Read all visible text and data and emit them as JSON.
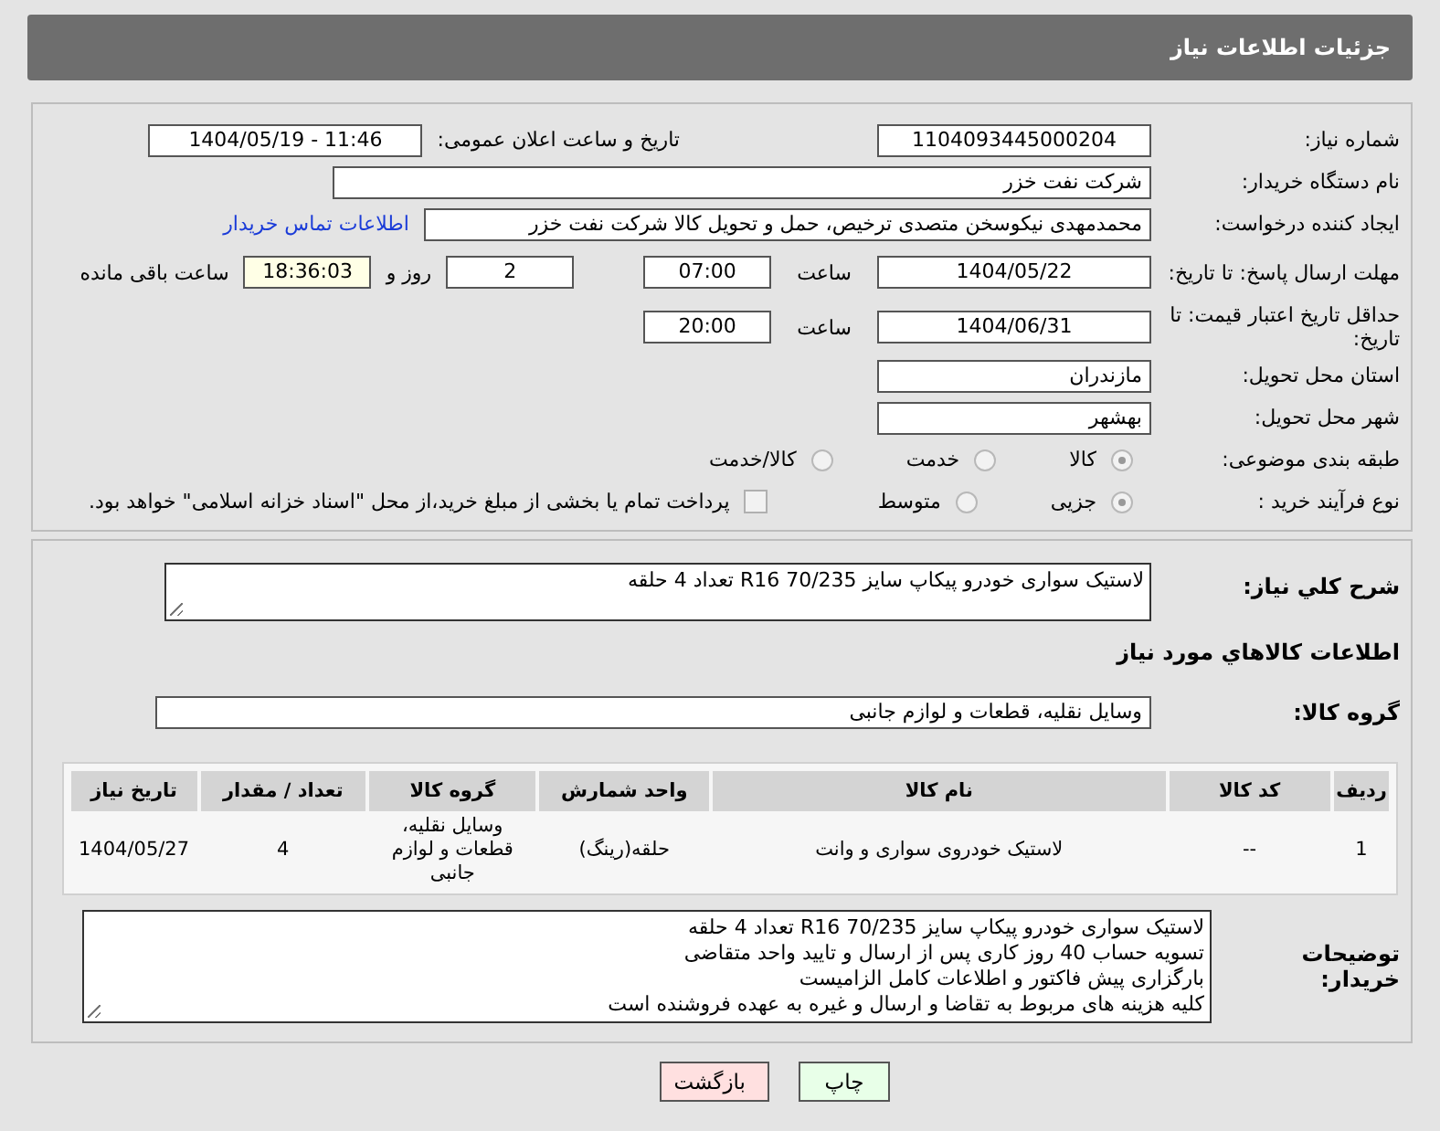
{
  "header": {
    "title": "جزئیات اطلاعات نیاز"
  },
  "form": {
    "need_number": {
      "label": "شماره نیاز:",
      "value": "1104093445000204"
    },
    "announce": {
      "label": "تاریخ و ساعت اعلان عمومی:",
      "value": "1404/05/19 - 11:46"
    },
    "buyer_org": {
      "label": "نام دستگاه خریدار:",
      "value": "شرکت نفت خزر"
    },
    "requester": {
      "label": "ایجاد کننده درخواست:",
      "value": "محمدمهدی نیکوسخن متصدی ترخیص، حمل و تحویل کالا شرکت نفت خزر",
      "link": "اطلاعات تماس خریدار"
    },
    "reply_deadline": {
      "label": "مهلت ارسال پاسخ: تا تاریخ:",
      "date": "1404/05/22",
      "time_label": "ساعت",
      "time": "07:00",
      "days": "2",
      "days_label": "روز و",
      "remaining": "18:36:03",
      "remaining_label": "ساعت باقی مانده"
    },
    "price_validity": {
      "label": "حداقل تاریخ اعتبار قیمت: تا تاریخ:",
      "date": "1404/06/31",
      "time_label": "ساعت",
      "time": "20:00"
    },
    "province": {
      "label": "استان محل تحویل:",
      "value": "مازندران"
    },
    "city": {
      "label": "شهر محل تحویل:",
      "value": "بهشهر"
    },
    "category": {
      "label": "طبقه بندی موضوعی:",
      "options": [
        {
          "label": "کالا",
          "selected": true
        },
        {
          "label": "خدمت",
          "selected": false
        },
        {
          "label": "کالا/خدمت",
          "selected": false
        }
      ]
    },
    "process": {
      "label": "نوع فرآیند خرید :",
      "options": [
        {
          "label": "جزیی",
          "selected": true
        },
        {
          "label": "متوسط",
          "selected": false
        }
      ],
      "payment": {
        "checked": false,
        "label": "پرداخت تمام یا بخشی از مبلغ خرید،از محل \"اسناد خزانه اسلامی\" خواهد بود."
      }
    }
  },
  "description": {
    "label": "شرح كلي نياز:",
    "value": "لاستیک سواری خودرو پیکاپ سایز 70/235  R16   تعداد 4 حلقه"
  },
  "goods": {
    "title": "اطلاعات كالاهاي مورد نياز",
    "group_label": "گروه کالا:",
    "group_value": "وسایل نقلیه، قطعات و لوازم جانبی",
    "table": {
      "columns": [
        "ردیف",
        "کد کالا",
        "نام کالا",
        "واحد شمارش",
        "گروه کالا",
        "تعداد / مقدار",
        "تاریخ نیاز"
      ],
      "rows": [
        [
          "1",
          "--",
          "لاستیک خودروی سواری و وانت",
          "حلقه(رینگ)",
          "وسایل نقلیه، قطعات و لوازم جانبی",
          "4",
          "1404/05/27"
        ]
      ]
    }
  },
  "buyer_notes": {
    "label": "توضیحات خریدار:",
    "lines": [
      "لاستیک سواری خودرو پیکاپ سایز 70/235  R16   تعداد 4 حلقه",
      "تسویه حساب 40 روز کاری پس از ارسال و تایید واحد متقاضی",
      "بارگزاری پیش فاکتور و اطلاعات کامل الزامیست",
      "کلیه هزینه های مربوط به تقاضا و ارسال و غیره به عهده فروشنده است"
    ]
  },
  "buttons": [
    {
      "label": "چاپ",
      "kind": "print"
    },
    {
      "label": "بازگشت",
      "kind": "back"
    }
  ]
}
